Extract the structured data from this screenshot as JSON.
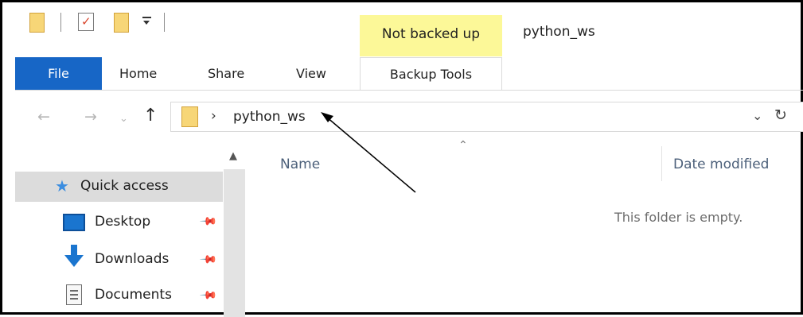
{
  "title_bar": {
    "window_title": "python_ws",
    "context_tab_title": "Not backed up",
    "context_tab_color": "#fcf898",
    "quick_access_icons": [
      "folder-icon",
      "properties-icon",
      "new-folder-icon",
      "customize-dropdown-icon"
    ]
  },
  "ribbon": {
    "file_label": "File",
    "file_color": "#1766c6",
    "tabs": [
      {
        "label": "Home"
      },
      {
        "label": "Share"
      },
      {
        "label": "View"
      }
    ],
    "context_tab_label": "Backup Tools"
  },
  "address_bar": {
    "back_icon": "back-arrow-icon",
    "forward_icon": "forward-arrow-icon",
    "recent_icon": "chevron-down-icon",
    "up_icon": "up-arrow-icon",
    "path": "python_ws",
    "refresh_icon": "refresh-icon"
  },
  "nav_pane": {
    "items": [
      {
        "label": "Quick access",
        "icon": "star-icon"
      },
      {
        "label": "Desktop",
        "icon": "desktop-icon"
      },
      {
        "label": "Downloads",
        "icon": "download-icon"
      },
      {
        "label": "Documents",
        "icon": "document-icon"
      }
    ]
  },
  "content": {
    "columns": [
      "Name",
      "Date modified"
    ],
    "empty_message": "This folder is empty."
  }
}
